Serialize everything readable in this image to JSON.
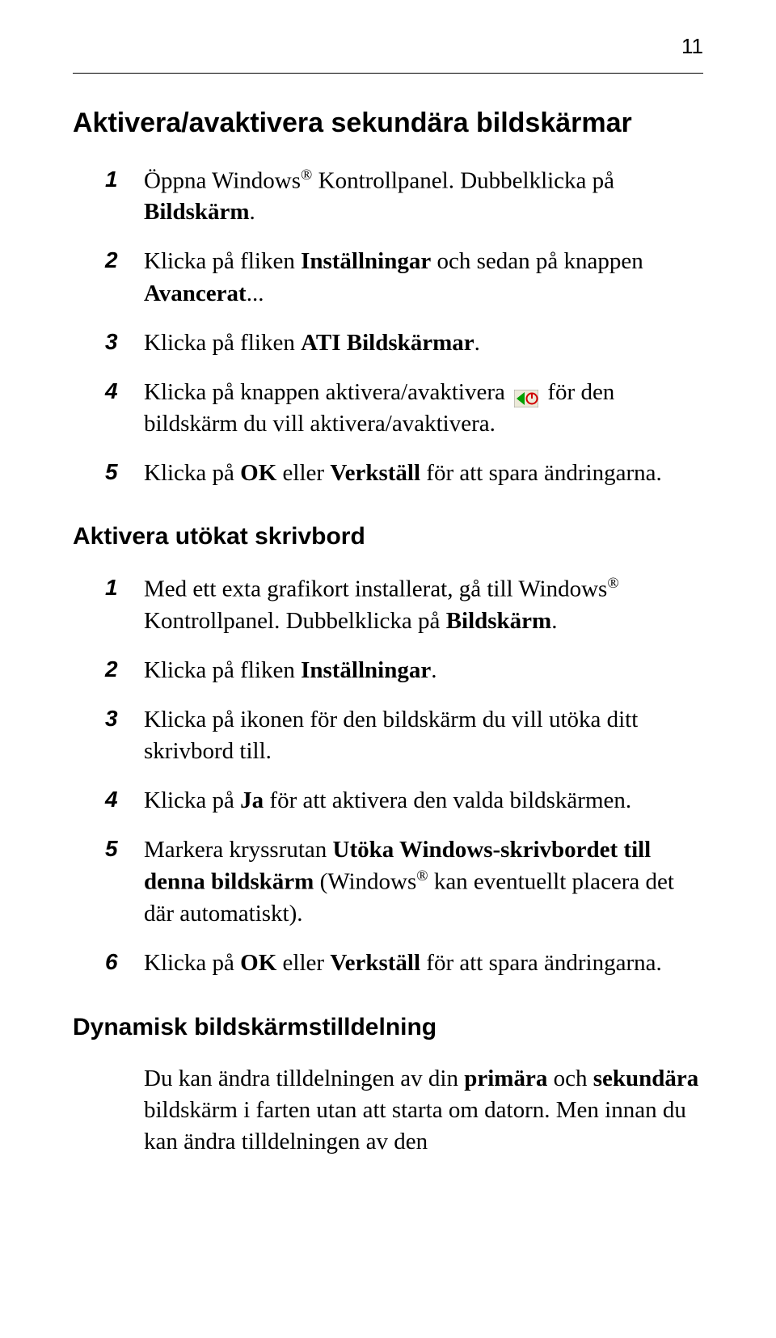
{
  "page_number": "11",
  "section1": {
    "title": "Aktivera/avaktivera sekundära bildskärmar",
    "steps": {
      "s1": {
        "num": "1",
        "t1": "Öppna Windows",
        "t2": " Kontrollpanel. Dubbelklicka på ",
        "t3": "Bildskärm",
        "t4": "."
      },
      "s2": {
        "num": "2",
        "t1": "Klicka på fliken ",
        "t2": "Inställningar",
        "t3": " och sedan på knappen ",
        "t4": "Avancerat",
        "t5": "..."
      },
      "s3": {
        "num": "3",
        "t1": "Klicka på fliken ",
        "t2": "ATI Bildskärmar",
        "t3": "."
      },
      "s4": {
        "num": "4",
        "t1": "Klicka på knappen aktivera/avaktivera ",
        "t2": " för den bildskärm du vill aktivera/avaktivera."
      },
      "s5": {
        "num": "5",
        "t1": "Klicka på ",
        "t2": "OK",
        "t3": " eller ",
        "t4": "Verkställ",
        "t5": " för att spara ändringarna."
      }
    }
  },
  "section2": {
    "title": "Aktivera utökat skrivbord",
    "steps": {
      "s1": {
        "num": "1",
        "t1": "Med ett exta grafikort installerat, gå till Windows",
        "t2": " Kontrollpanel. Dubbelklicka på ",
        "t3": "Bildskärm",
        "t4": "."
      },
      "s2": {
        "num": "2",
        "t1": "Klicka på fliken ",
        "t2": "Inställningar",
        "t3": "."
      },
      "s3": {
        "num": "3",
        "t1": "Klicka på ikonen för den bildskärm du vill utöka ditt skrivbord till."
      },
      "s4": {
        "num": "4",
        "t1": "Klicka på ",
        "t2": "Ja",
        "t3": " för att aktivera den valda bildskärmen."
      },
      "s5": {
        "num": "5",
        "t1": "Markera kryssrutan ",
        "t2": "Utöka Windows-skrivbordet till denna bildskärm",
        "t3": " (Windows",
        "t4": " kan eventuellt placera det där automatiskt)."
      },
      "s6": {
        "num": "6",
        "t1": "Klicka på ",
        "t2": "OK",
        "t3": " eller ",
        "t4": "Verkställ",
        "t5": " för att spara ändringarna."
      }
    }
  },
  "section3": {
    "title": "Dynamisk bildskärmstilldelning",
    "para": {
      "t1": "Du kan ändra tilldelningen av din ",
      "t2": "primära",
      "t3": " och ",
      "t4": "sekundära",
      "t5": " bildskärm i farten utan att starta om datorn. Men innan du kan ändra tilldelningen av den"
    }
  }
}
